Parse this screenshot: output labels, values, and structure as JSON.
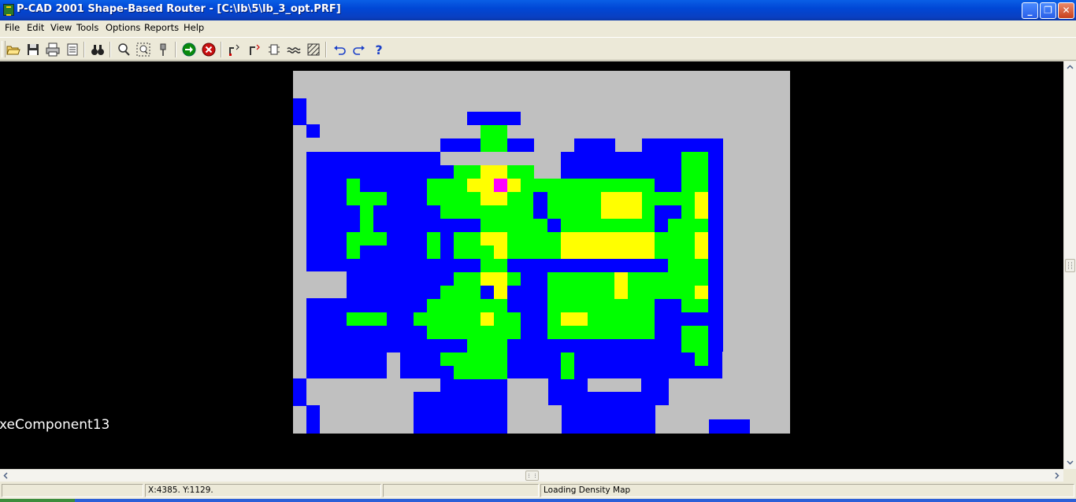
{
  "window": {
    "title": "P-CAD 2001 Shape-Based Router - [C:\\lb\\5\\lb_3_opt.PRF]",
    "minimize_label": "_",
    "restore_label": "❐",
    "close_label": "✕"
  },
  "menu": {
    "items": [
      {
        "name": "menu-file",
        "label": "File"
      },
      {
        "name": "menu-edit",
        "label": "Edit"
      },
      {
        "name": "menu-view",
        "label": "View"
      },
      {
        "name": "menu-tools",
        "label": "Tools"
      },
      {
        "name": "menu-options",
        "label": "Options"
      },
      {
        "name": "menu-reports",
        "label": "Reports"
      },
      {
        "name": "menu-help",
        "label": "Help"
      }
    ]
  },
  "toolbar": {
    "buttons": [
      {
        "name": "open-icon",
        "icon": "open-folder"
      },
      {
        "name": "save-icon",
        "icon": "floppy-disk"
      },
      {
        "name": "print-icon",
        "icon": "printer"
      },
      {
        "name": "print-setup-icon",
        "icon": "document-stack"
      },
      {
        "name": "find-icon",
        "icon": "binoculars"
      },
      {
        "name": "zoom-icon",
        "icon": "magnifier"
      },
      {
        "name": "zoom-window-icon",
        "icon": "zoom-window"
      },
      {
        "name": "pin-icon",
        "icon": "push-pin"
      },
      {
        "name": "start-route-icon",
        "icon": "green-arrow"
      },
      {
        "name": "stop-route-icon",
        "icon": "red-x"
      },
      {
        "name": "route-net-icon",
        "icon": "route-net"
      },
      {
        "name": "route-connection-icon",
        "icon": "route-connection"
      },
      {
        "name": "route-component-icon",
        "icon": "route-component"
      },
      {
        "name": "density-icon",
        "icon": "wave"
      },
      {
        "name": "congestion-icon",
        "icon": "hatched"
      },
      {
        "name": "undo-icon",
        "icon": "undo"
      },
      {
        "name": "redo-icon",
        "icon": "redo"
      },
      {
        "name": "help-icon",
        "icon": "question-mark"
      }
    ]
  },
  "canvas": {
    "overlay_text": "xeComponent13",
    "colors": {
      "background": "#000000",
      "board": "#c0c0c0",
      "low_density": "#0000ff",
      "medium_density": "#00ff00",
      "high_density": "#ffff00",
      "peak_density": "#ff00ff"
    }
  },
  "status": {
    "coordinates": "X:4385. Y:1129.",
    "message": "Loading Density Map"
  }
}
